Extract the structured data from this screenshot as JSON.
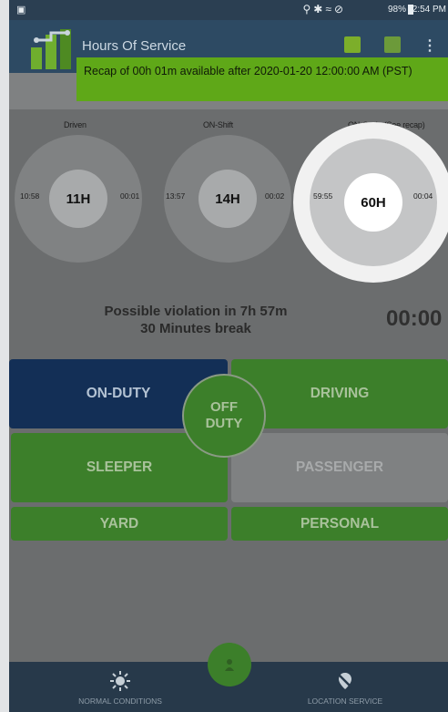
{
  "status_bar": {
    "battery": "98%",
    "time": "2:54 PM"
  },
  "app_bar": {
    "title": "Hours Of Service"
  },
  "recap_tooltip": {
    "text": "Recap of 00h 01m available after 2020-01-20 12:00:00 AM (PST)"
  },
  "gauges": [
    {
      "title": "Driven",
      "left": "10:58",
      "center": "11H",
      "right": "00:01"
    },
    {
      "title": "ON-Shift",
      "left": "13:57",
      "center": "14H",
      "right": "00:02"
    },
    {
      "title": "ON-Cycle (See recap)",
      "left": "59:55",
      "center": "60H",
      "right": "00:04"
    }
  ],
  "violation": {
    "line1": "Possible violation in 7h 57m",
    "line2": "30 Minutes break",
    "timer": "00:00"
  },
  "duty_status": {
    "on_duty": "ON-DUTY",
    "driving": "DRIVING",
    "off_duty_line1": "OFF",
    "off_duty_line2": "DUTY",
    "sleeper": "SLEEPER",
    "passenger": "PASSENGER",
    "yard": "YARD",
    "personal": "PERSONAL"
  },
  "bottom_nav": {
    "normal_conditions": "NORMAL CONDITIONS",
    "location_service": "LOCATION SERVICE"
  },
  "colors": {
    "status_bar": "#2b3f52",
    "app_bar": "#2d4a63",
    "tooltip": "#5fa818",
    "on_duty": "#132f56",
    "green_button": "#3c7f2a",
    "disabled_button": "#7f8182",
    "bottom_bar": "#27394a"
  }
}
